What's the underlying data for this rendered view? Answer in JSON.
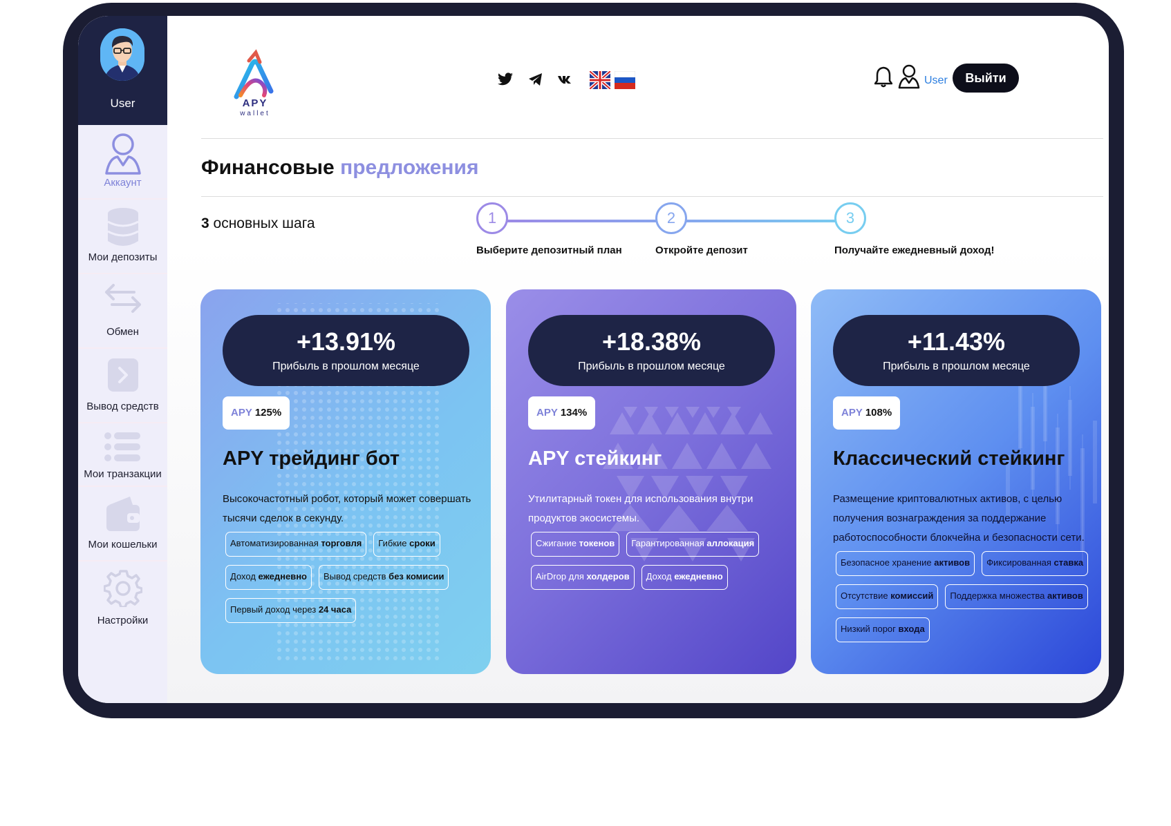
{
  "sidebar": {
    "user_name": "User",
    "items": [
      {
        "label": "Аккаунт",
        "icon": "user-icon"
      },
      {
        "label": "Мои депозиты",
        "icon": "database-icon"
      },
      {
        "label": "Обмен",
        "icon": "exchange-arrows-icon"
      },
      {
        "label": "Вывод средств",
        "icon": "withdraw-icon"
      },
      {
        "label": "Мои транзакции",
        "icon": "list-icon"
      },
      {
        "label": "Мои кошельки",
        "icon": "wallet-icon"
      },
      {
        "label": "Настройки",
        "icon": "gear-icon"
      }
    ]
  },
  "header": {
    "logo_text": "APY",
    "logo_sub": "wallet",
    "social": [
      "twitter-icon",
      "telegram-icon",
      "vk-icon"
    ],
    "languages": [
      "en-flag-icon",
      "ru-flag-icon"
    ],
    "user_label": "User",
    "logout_label": "Выйти"
  },
  "page": {
    "title_main": "Финансовые",
    "title_accent": "предложения",
    "steps_title_num": "3",
    "steps_title_rest": "основных шага",
    "steps": [
      {
        "num": "1",
        "label": "Выберите депозитный план"
      },
      {
        "num": "2",
        "label": "Откройте депозит"
      },
      {
        "num": "3",
        "label": "Получайте ежедневный доход!"
      }
    ]
  },
  "cards": [
    {
      "profit": "+13.91%",
      "profit_label": "Прибыль в прошлом месяце",
      "apy_key": "APY",
      "apy_value": "125%",
      "title": "APY трейдинг бот",
      "description": "Высокочастотный робот, который может совершать тысячи сделок в секунду.",
      "tags": [
        {
          "plain": "Автоматизированная",
          "bold": "торговля"
        },
        {
          "plain": "Гибкие",
          "bold": "сроки"
        },
        {
          "plain": "Доход",
          "bold": "ежедневно"
        },
        {
          "plain": "Вывод средств",
          "bold": "без комисии"
        },
        {
          "plain": "Первый доход через",
          "bold": "24 часа"
        }
      ]
    },
    {
      "profit": "+18.38%",
      "profit_label": "Прибыль в прошлом месяце",
      "apy_key": "APY",
      "apy_value": "134%",
      "title": "APY стейкинг",
      "description": "Утилитарный токен для использования внутри продуктов экосистемы.",
      "tags": [
        {
          "plain": "Сжигание",
          "bold": "токенов"
        },
        {
          "plain": "Гарантированная",
          "bold": "аллокация"
        },
        {
          "plain": "AirDrop для",
          "bold": "холдеров"
        },
        {
          "plain": "Доход",
          "bold": "ежедневно"
        }
      ]
    },
    {
      "profit": "+11.43%",
      "profit_label": "Прибыль в прошлом месяце",
      "apy_key": "APY",
      "apy_value": "108%",
      "title": "Классический стейкинг",
      "description": "Размещение криптовалютных активов, с целью получения вознаграждения за поддержание работоспособности блокчейна и безопасности сети.",
      "tags": [
        {
          "plain": "Безопасное хранение",
          "bold": "активов"
        },
        {
          "plain": "Фиксированная",
          "bold": "ставка"
        },
        {
          "plain": "Отсутствие",
          "bold": "комиссий"
        },
        {
          "plain": "Поддержка множества",
          "bold": "активов"
        },
        {
          "plain": "Низкий порог",
          "bold": "входа"
        }
      ]
    }
  ],
  "colors": {
    "sidebar_head": "#1e2344",
    "accent": "#8d8fe0",
    "logout_bg": "#0d0e1a",
    "profit_pill": "#1e2446"
  }
}
